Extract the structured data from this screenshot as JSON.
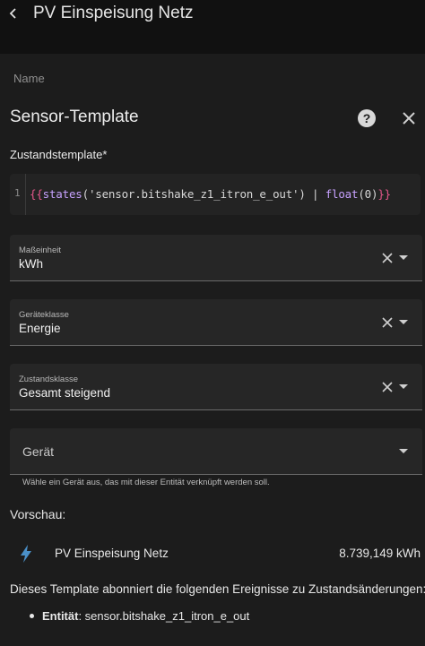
{
  "header": {
    "title": "PV Einspeisung Netz"
  },
  "dialog": {
    "name_label": "Name",
    "title": "Sensor-Template",
    "help_glyph": "?",
    "template_label": "Zustandstemplate*",
    "editor": {
      "line_number": "1",
      "code": {
        "open": "{{",
        "fn1": "states",
        "arg": "('sensor.bitshake_z1_itron_e_out')",
        "pipe": " | ",
        "fn2": "float",
        "arg2": "(0)",
        "close": "}}"
      }
    },
    "fields": {
      "unit": {
        "label": "Maßeinheit",
        "value": "kWh"
      },
      "device_class": {
        "label": "Geräteklasse",
        "value": "Energie"
      },
      "state_class": {
        "label": "Zustandsklasse",
        "value": "Gesamt steigend"
      },
      "device": {
        "placeholder": "Gerät",
        "helper": "Wähle ein Gerät aus, das mit dieser Entität verknüpft werden soll."
      }
    },
    "preview": {
      "label": "Vorschau:",
      "entity_name": "PV Einspeisung Netz",
      "entity_value": "8.739,149 kWh",
      "icon": "lightning-bolt-icon"
    },
    "subscription_text": "Dieses Template abonniert die folgenden Ereignisse zu Zustandsänderungen:",
    "subscriptions": [
      {
        "key": "Entität",
        "value": ": sensor.bitshake_z1_itron_e_out"
      }
    ]
  },
  "colors": {
    "background": "#111111",
    "dialog": "#1c1c1c",
    "field": "#262626",
    "accent_bolt": "#4a90c8"
  }
}
